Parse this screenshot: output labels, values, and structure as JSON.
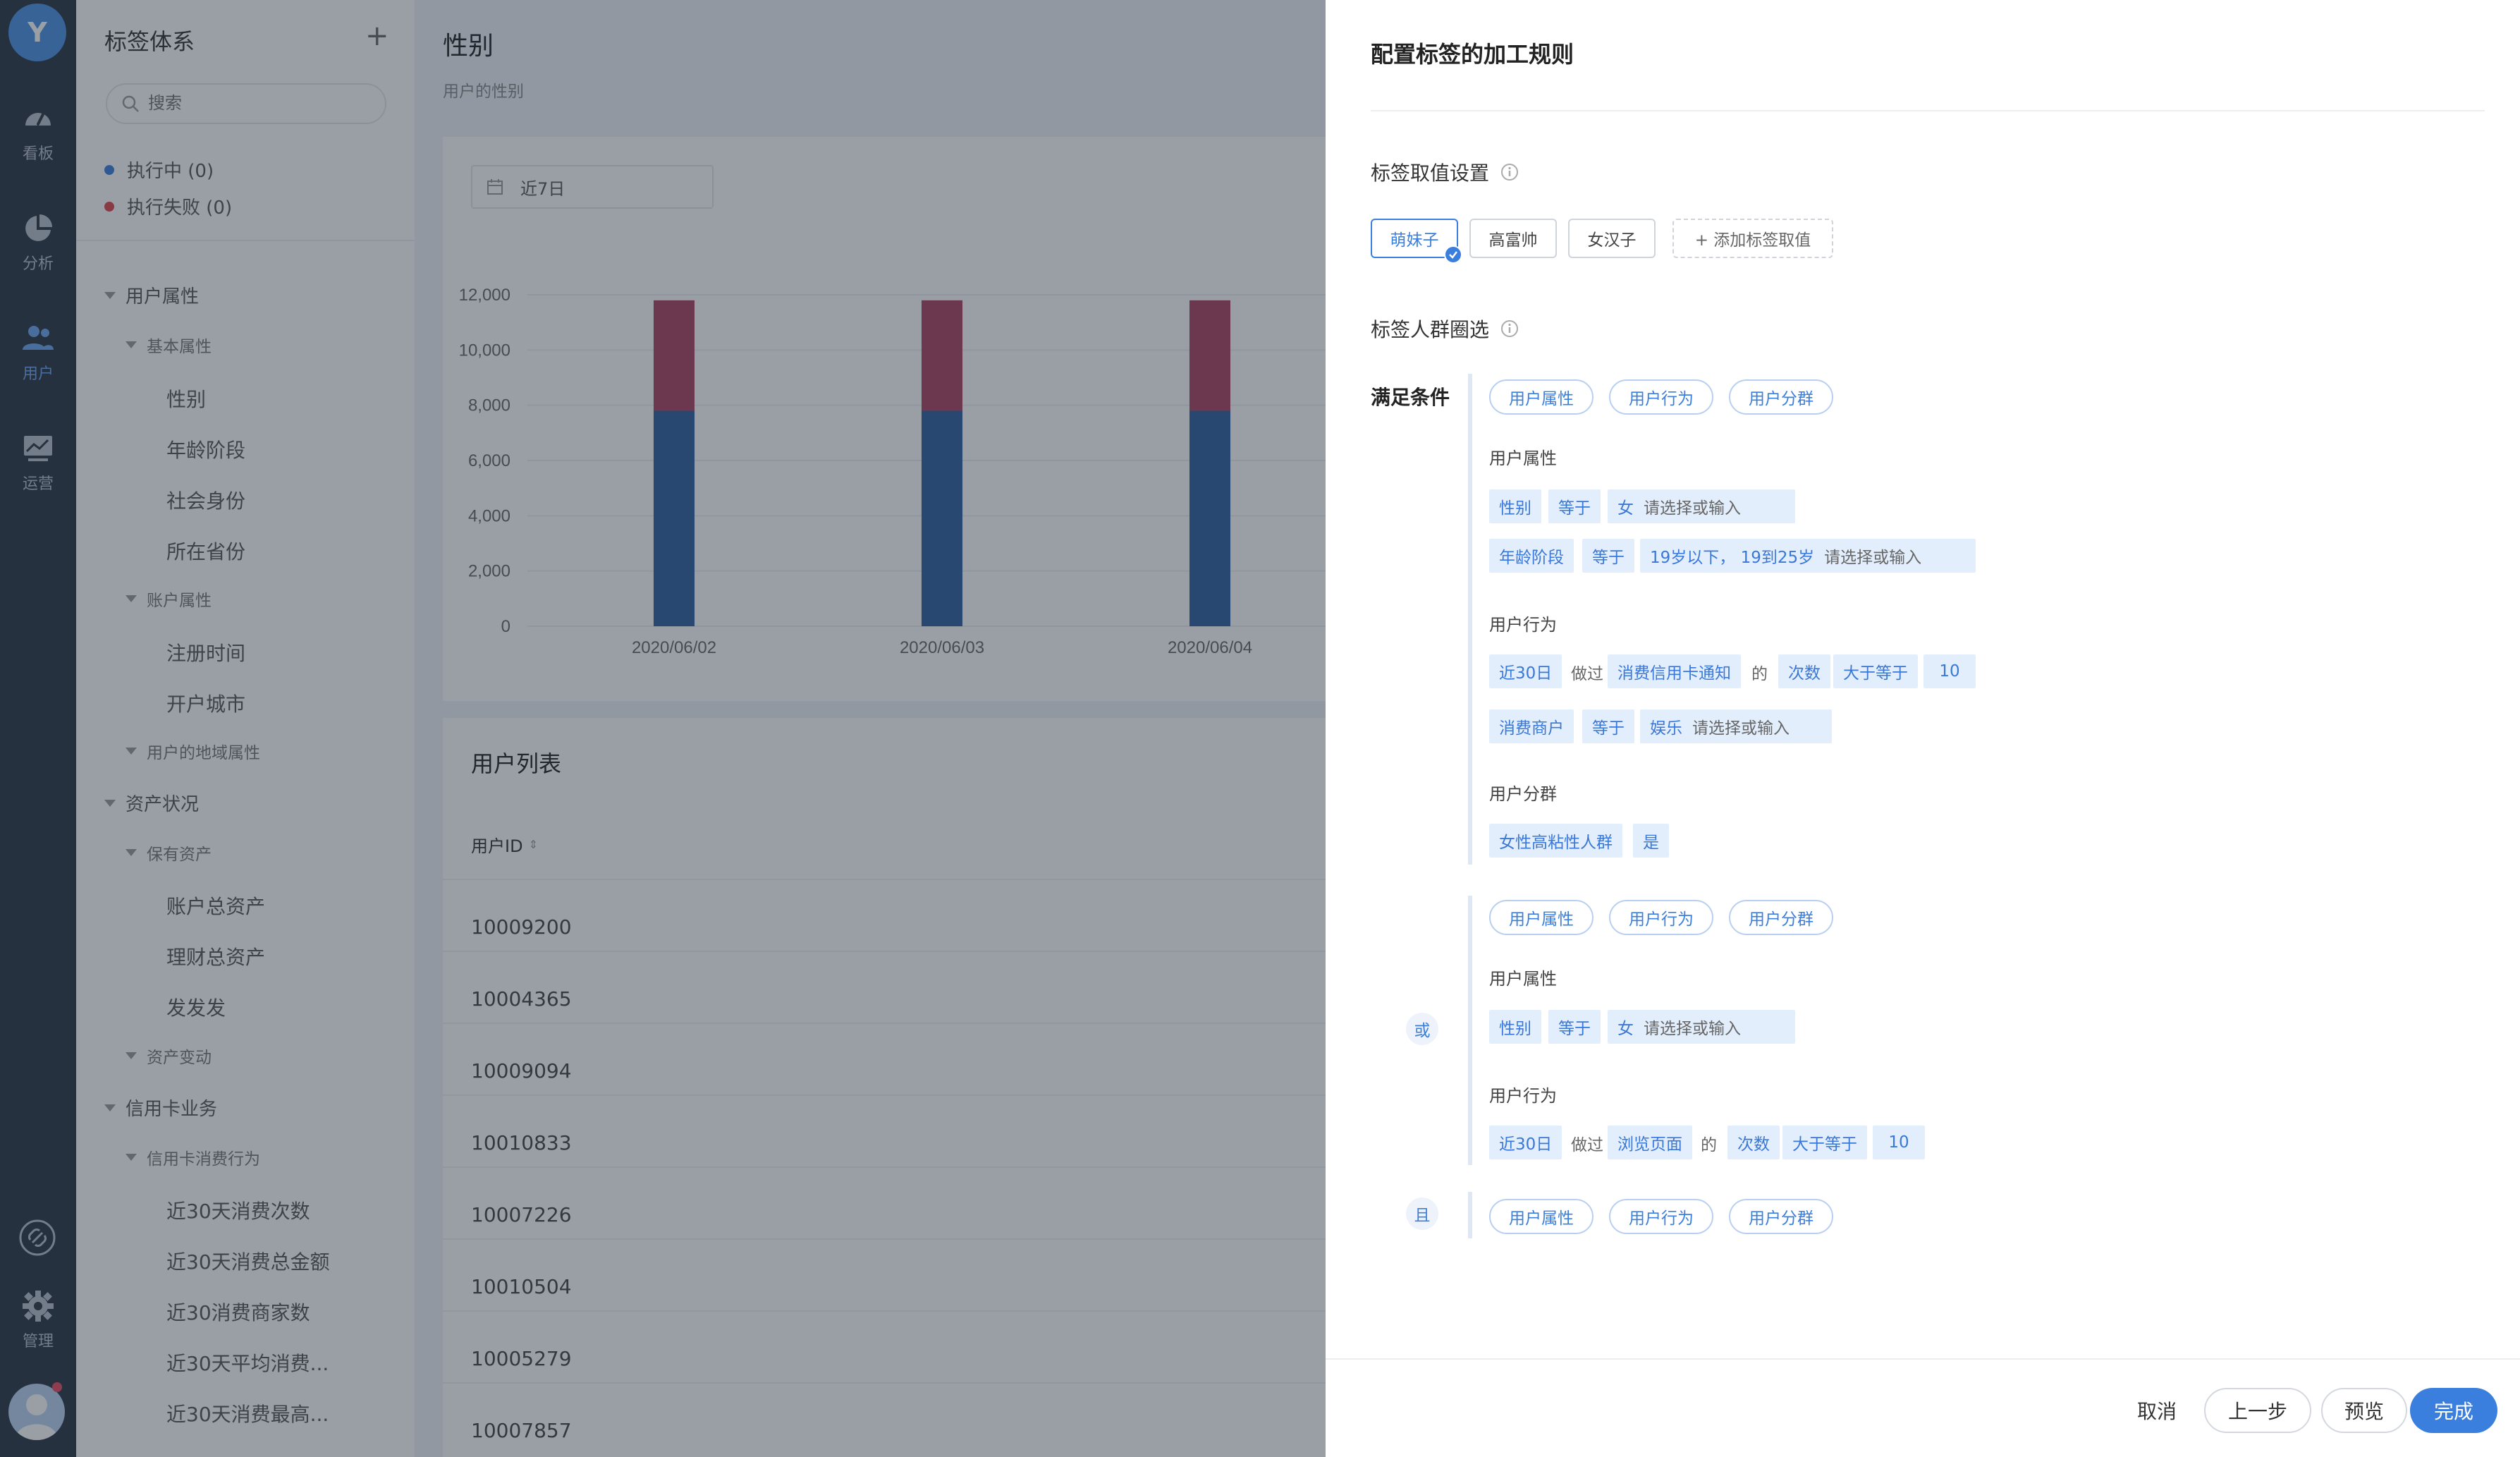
{
  "rail": {
    "logo": "Y",
    "items": [
      {
        "label": "看板",
        "icon": "dashboard-gauge-icon"
      },
      {
        "label": "分析",
        "icon": "pie-chart-icon"
      },
      {
        "label": "用户",
        "icon": "users-icon"
      },
      {
        "label": "运营",
        "icon": "monitor-chart-icon"
      }
    ],
    "bottom": [
      {
        "icon": "link-icon"
      },
      {
        "label": "管理",
        "icon": "gear-icon"
      }
    ],
    "active_index": 2
  },
  "tree": {
    "title": "标签体系",
    "add_icon": "plus-icon",
    "search_placeholder": "搜索",
    "status": [
      {
        "label": "执行中 (0)",
        "color": "#3b7fde"
      },
      {
        "label": "执行失败 (0)",
        "color": "#e0474c"
      }
    ],
    "nodes": [
      {
        "label": "用户属性",
        "level": 0
      },
      {
        "label": "基本属性",
        "level": 1
      },
      {
        "label": "性别",
        "level": 2
      },
      {
        "label": "年龄阶段",
        "level": 2
      },
      {
        "label": "社会身份",
        "level": 2
      },
      {
        "label": "所在省份",
        "level": 2
      },
      {
        "label": "账户属性",
        "level": 1
      },
      {
        "label": "注册时间",
        "level": 2
      },
      {
        "label": "开户城市",
        "level": 2
      },
      {
        "label": "用户的地域属性",
        "level": 1
      },
      {
        "label": "资产状况",
        "level": 0
      },
      {
        "label": "保有资产",
        "level": 1
      },
      {
        "label": "账户总资产",
        "level": 2
      },
      {
        "label": "理财总资产",
        "level": 2
      },
      {
        "label": "发发发",
        "level": 2
      },
      {
        "label": "资产变动",
        "level": 1
      },
      {
        "label": "信用卡业务",
        "level": 0
      },
      {
        "label": "信用卡消费行为",
        "level": 1
      },
      {
        "label": "近30天消费次数",
        "level": 2
      },
      {
        "label": "近30天消费总金额",
        "level": 2
      },
      {
        "label": "近30消费商家数",
        "level": 2
      },
      {
        "label": "近30天平均消费...",
        "level": 2
      },
      {
        "label": "近30天消费最高...",
        "level": 2
      }
    ]
  },
  "main": {
    "title": "性别",
    "subtitle": "用户的性别",
    "date_range": "近7日",
    "chart_data": {
      "type": "bar",
      "stacked": true,
      "categories": [
        "2020/06/02",
        "2020/06/03",
        "2020/06/04"
      ],
      "series": [
        {
          "values": [
            7800,
            7800,
            7800
          ],
          "color": "#2e5f9e"
        },
        {
          "values": [
            4000,
            4000,
            4000
          ],
          "color": "#a8425f"
        }
      ],
      "y_ticks": [
        "0",
        "2,000",
        "4,000",
        "6,000",
        "8,000",
        "10,000",
        "12,000"
      ],
      "ylim": [
        0,
        12000
      ],
      "grid": true
    },
    "table": {
      "title": "用户列表",
      "column": "用户ID",
      "rows": [
        "10009200",
        "10004365",
        "10009094",
        "10010833",
        "10007226",
        "10010504",
        "10005279",
        "10007857"
      ]
    }
  },
  "drawer": {
    "title": "配置标签的加工规则",
    "value_section": "标签取值设置",
    "values": [
      "萌妹子",
      "高富帅",
      "女汉子"
    ],
    "add_value": "+ 添加标签取值",
    "crowd_section": "标签人群圈选",
    "condition_label": "满足条件",
    "pill_labels": [
      "用户属性",
      "用户行为",
      "用户分群"
    ],
    "group1": {
      "attr_label": "用户属性",
      "attr_rows": [
        {
          "field": "性别",
          "op": "等于",
          "value": "女",
          "placeholder": "请选择或输入"
        },
        {
          "field": "年龄阶段",
          "op": "等于",
          "value": "19岁以下， 19到25岁",
          "placeholder": "请选择或输入"
        }
      ],
      "behavior_label": "用户行为",
      "behavior_row": {
        "period": "近30日",
        "did": "做过",
        "event": "消费信用卡通知",
        "of": "的",
        "metric": "次数",
        "cmp": "大于等于",
        "num": "10"
      },
      "behavior_attr_row": {
        "field": "消费商户",
        "op": "等于",
        "value": "娱乐",
        "placeholder": "请选择或输入"
      },
      "segment_label": "用户分群",
      "segment_row": {
        "name": "女性高粘性人群",
        "value": "是"
      }
    },
    "or_label": "或",
    "group2": {
      "attr_label": "用户属性",
      "attr_row": {
        "field": "性别",
        "op": "等于",
        "value": "女",
        "placeholder": "请选择或输入"
      },
      "behavior_label": "用户行为",
      "behavior_row": {
        "period": "近30日",
        "did": "做过",
        "event": "浏览页面",
        "of": "的",
        "metric": "次数",
        "cmp": "大于等于",
        "num": "10"
      }
    },
    "and_label": "且",
    "footer": {
      "cancel": "取消",
      "prev": "上一步",
      "preview": "预览",
      "done": "完成"
    }
  }
}
